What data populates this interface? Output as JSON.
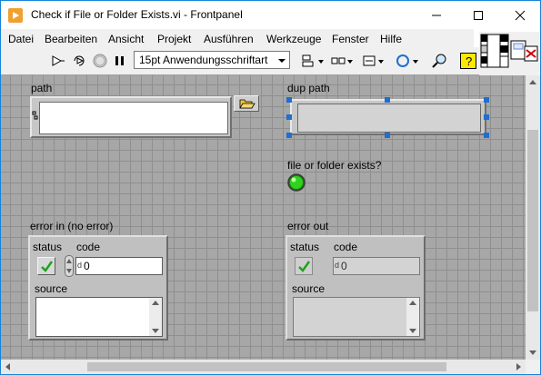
{
  "window": {
    "title": "Check if File or Folder Exists.vi - Frontpanel"
  },
  "menu": [
    "Datei",
    "Bearbeiten",
    "Ansicht",
    "Projekt",
    "Ausführen",
    "Werkzeuge",
    "Fenster",
    "Hilfe"
  ],
  "toolbar": {
    "font": "15pt Anwendungsschriftart"
  },
  "panel": {
    "path_label": "path",
    "dup_path_label": "dup path",
    "exists_label": "file or folder exists?",
    "error_in": {
      "title": "error in (no error)",
      "status_label": "status",
      "code_label": "code",
      "code_value": "0",
      "code_prefix": "d",
      "source_label": "source"
    },
    "error_out": {
      "title": "error out",
      "status_label": "status",
      "code_label": "code",
      "code_value": "0",
      "code_prefix": "d",
      "source_label": "source"
    }
  },
  "colors": {
    "canvas": "#a7a7a7",
    "led_on": "#2fd21f",
    "accent": "#1883d7"
  }
}
